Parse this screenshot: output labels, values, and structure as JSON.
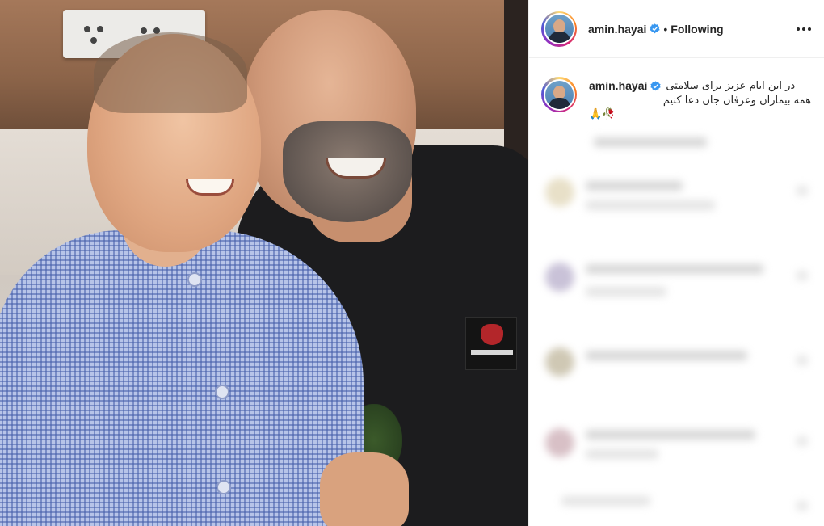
{
  "header": {
    "username": "amin.hayai",
    "separator": "•",
    "follow_status": "Following"
  },
  "caption": {
    "username": "amin.hayai",
    "line1": "در این ایام عزیز برای سلامتی",
    "line2": "همه بیماران وعرفان جان دعا کنیم",
    "emoji": "🙏🥀"
  },
  "icons": {
    "verified": "verified-badge-icon",
    "more": "more-options-icon"
  },
  "colors": {
    "text": "#262626",
    "verified": "#3897f0",
    "border": "#efefef"
  }
}
